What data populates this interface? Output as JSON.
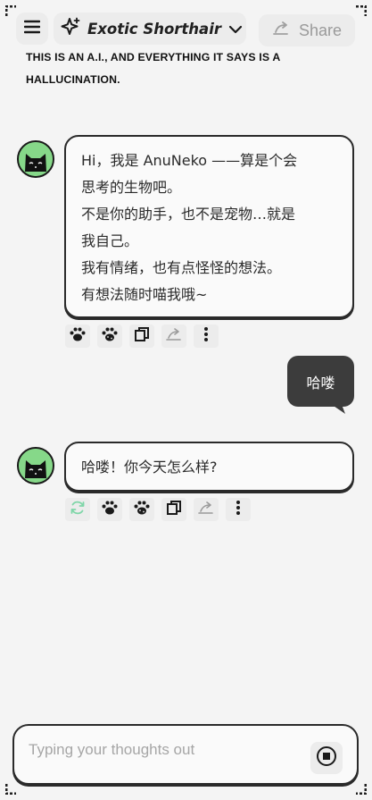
{
  "header": {
    "model_name": "Exotic Shorthair",
    "share_label": "Share"
  },
  "disclaimer": {
    "line1": "THIS IS AN A.I., AND EVERYTHING IT SAYS IS A",
    "line2": "HALLUCINATION."
  },
  "messages": [
    {
      "role": "assistant",
      "lines": [
        "Hi，我是 AnuNeko ——算是个会",
        "思考的生物吧。",
        "不是你的助手，也不是宠物…就是",
        "我自己。",
        "我有情绪，也有点怪怪的想法。",
        "有想法随时喵我哦~"
      ]
    },
    {
      "role": "user",
      "text": "哈喽"
    },
    {
      "role": "assistant",
      "lines": [
        "哈喽！你今天怎么样?"
      ]
    }
  ],
  "composer": {
    "placeholder": "Typing your thoughts out",
    "value": ""
  },
  "colors": {
    "background": "#f4f4f4",
    "avatar_green": "#86d889",
    "user_bubble": "#3c3c3c",
    "regenerate_icon": "#7fd6a8"
  },
  "icons": {
    "menu": "hamburger-icon",
    "model": "sparkle-icon",
    "dropdown": "chevron-down-icon",
    "share": "share-arrow-icon",
    "like": "paw-icon",
    "dislike": "paw-dotted-icon",
    "copy": "copy-icon",
    "share_msg": "share-arrow-icon",
    "more": "more-vertical-icon",
    "regenerate": "refresh-icon",
    "send": "stop-icon"
  }
}
